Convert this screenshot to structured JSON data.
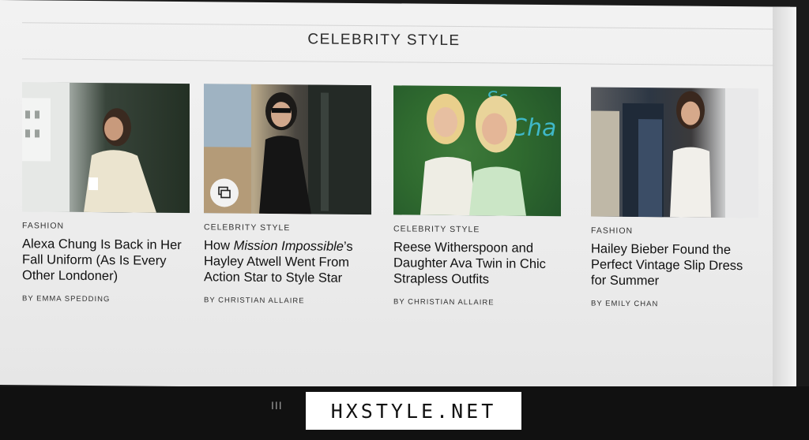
{
  "section": {
    "title": "CELEBRITY STYLE"
  },
  "cards": [
    {
      "kicker": "FASHION",
      "headline": "Alexa Chung Is Back in Her Fall Uniform (As Is Every Other Londoner)",
      "byline": "BY EMMA SPEDDING"
    },
    {
      "kicker": "CELEBRITY STYLE",
      "headline_pre": "How ",
      "headline_em": "Mission Impossible",
      "headline_post": "’s Hayley Atwell Went From Action Star to Style Star",
      "byline": "BY CHRISTIAN ALLAIRE",
      "badge_icon": "gallery-icon"
    },
    {
      "kicker": "CELEBRITY STYLE",
      "headline": "Reese Witherspoon and Daughter Ava Twin in Chic Strapless Outfits",
      "byline": "BY CHRISTIAN ALLAIRE"
    },
    {
      "kicker": "FASHION",
      "headline": "Hailey Bieber Found the Perfect Vintage Slip Dress for Summer",
      "byline": "BY EMILY CHAN"
    }
  ],
  "system_nav": {
    "recents_icon": "recent-apps-icon",
    "recents_glyph": "III"
  },
  "watermark": {
    "text": "HXSTYLE.NET"
  }
}
